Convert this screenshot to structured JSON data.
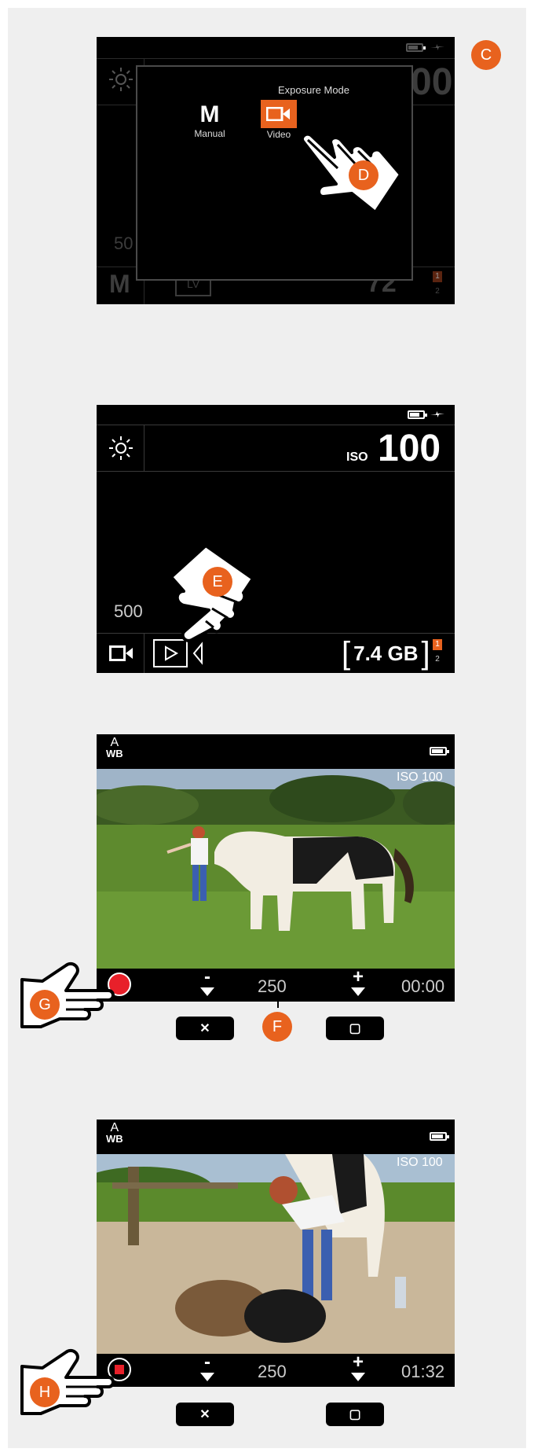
{
  "screen1": {
    "dialog_title": "Exposure Mode",
    "manual_glyph": "M",
    "manual_label": "Manual",
    "video_label": "Video",
    "bg_value": "50",
    "bg_mode": "M",
    "bg_lv": "LV",
    "bg_shots": "72",
    "bg_iso_partial": "00",
    "card1": "1",
    "card2": "2"
  },
  "screen2": {
    "iso_label": "ISO",
    "iso_value": "100",
    "value_left": "500",
    "storage": "7.4 GB",
    "card1": "1",
    "card2": "2"
  },
  "screen3": {
    "wb_a": "A",
    "wb_label": "WB",
    "iso": "ISO 100",
    "minus": "-",
    "plus": "+",
    "value": "250",
    "time": "00:00"
  },
  "screen4": {
    "wb_a": "A",
    "wb_label": "WB",
    "iso": "ISO 100",
    "minus": "-",
    "plus": "+",
    "value": "250",
    "time": "01:32"
  },
  "buttons": {
    "close_glyph": "✕",
    "square_glyph": "▢"
  },
  "callouts": {
    "c": "C",
    "d": "D",
    "e": "E",
    "f": "F",
    "g": "G",
    "h": "H"
  },
  "colors": {
    "accent": "#e8621e",
    "record": "#e8202a",
    "panel_bg": "#efefef",
    "screen_bg": "#000000"
  },
  "icons": [
    "battery-icon",
    "charging-icon",
    "brightness-icon",
    "video-camera-icon",
    "play-icon",
    "record-button-icon",
    "hand-pointer-icon",
    "close-icon",
    "square-icon",
    "arrow-down-icon"
  ]
}
